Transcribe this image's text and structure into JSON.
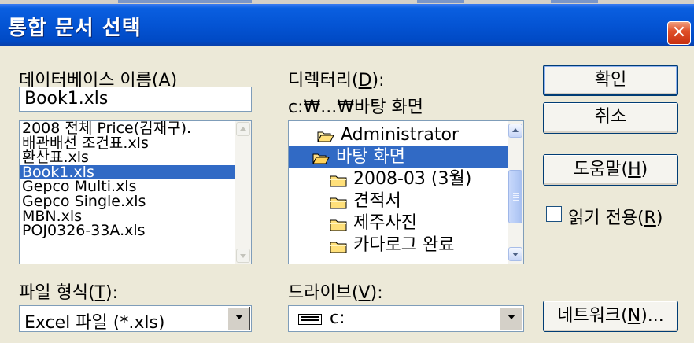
{
  "window": {
    "title": "통합 문서 선택",
    "close_glyph": "✕"
  },
  "filename": {
    "label_pre": "데이터베이스 이름(",
    "label_key": "A",
    "label_post": ")",
    "value": "Book1.xls",
    "files": [
      "2008 전체 Price(김재구).",
      "배관배선 조건표.xls",
      "환산표.xls",
      "Book1.xls",
      "Gepco Multi.xls",
      "Gepco Single.xls",
      "MBN.xls",
      "POJ0326-33A.xls"
    ],
    "selected_index": 3
  },
  "directory": {
    "label_pre": "디렉터리(",
    "label_key": "D",
    "label_post": "):",
    "path": "c:₩...₩바탕 화면",
    "folders": [
      {
        "name": "Administrator",
        "icon": "open-folder-icon"
      },
      {
        "name": "바탕 화면",
        "icon": "open-folder-icon"
      },
      {
        "name": "2008-03 (3월)",
        "icon": "folder-icon"
      },
      {
        "name": "견적서",
        "icon": "folder-icon"
      },
      {
        "name": "제주사진",
        "icon": "folder-icon"
      },
      {
        "name": "카다로그 완료",
        "icon": "folder-icon"
      }
    ],
    "selected_index": 1
  },
  "filetype": {
    "label_pre": "파일 형식(",
    "label_key": "T",
    "label_post": "):",
    "value": "Excel 파일 (*.xls)"
  },
  "drive": {
    "label_pre": "드라이브(",
    "label_key": "V",
    "label_post": "):",
    "value": "c:",
    "icon": "drive-icon"
  },
  "buttons": {
    "ok": "확인",
    "cancel": "취소",
    "help_pre": "도움말(",
    "help_key": "H",
    "help_post": ")",
    "network_pre": "네트워크(",
    "network_key": "N",
    "network_post": ")..."
  },
  "readonly": {
    "label_pre": "읽기 전용(",
    "label_key": "R",
    "label_post": ")",
    "checked": false
  },
  "colors": {
    "title_bar": "#0454d4",
    "selection": "#316ac5",
    "dialog_bg": "#ece9d8"
  }
}
